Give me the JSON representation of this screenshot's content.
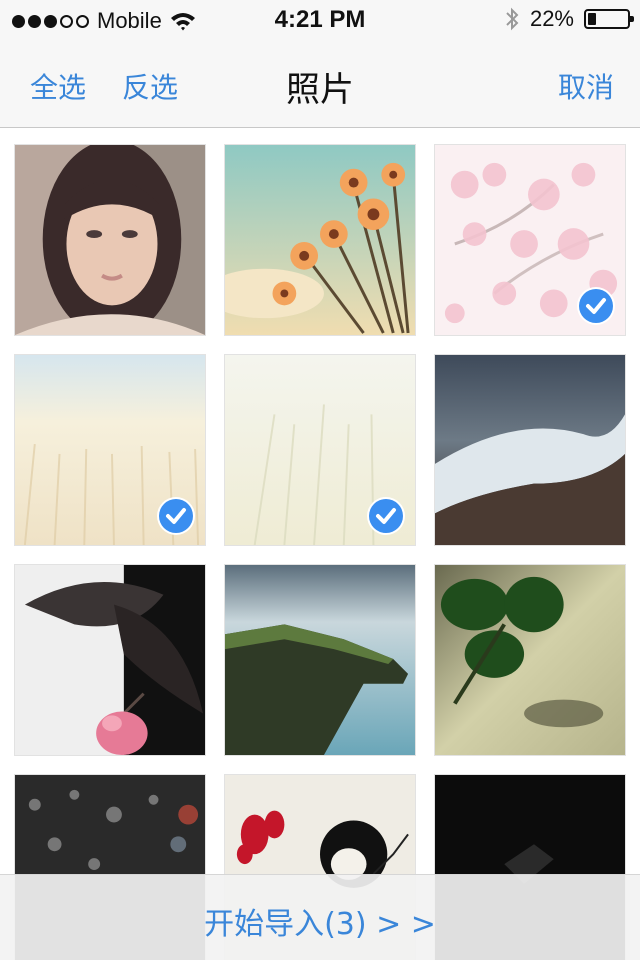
{
  "status_bar": {
    "carrier": "Mobile",
    "time": "4:21 PM",
    "battery_percent": "22%",
    "battery_level": 0.22,
    "signal_bars_filled": 3,
    "signal_bars_total": 5
  },
  "nav": {
    "select_all": "全选",
    "invert_selection": "反选",
    "title": "照片",
    "cancel": "取消"
  },
  "photos": [
    {
      "subject": "portrait of a woman with bangs",
      "selected": false
    },
    {
      "subject": "daisies against a sky",
      "selected": false
    },
    {
      "subject": "pink cherry blossoms",
      "selected": true
    },
    {
      "subject": "pale wheat field",
      "selected": true
    },
    {
      "subject": "faded grass field",
      "selected": true
    },
    {
      "subject": "ocean wave on beach",
      "selected": false
    },
    {
      "subject": "pink flower with dark leaves",
      "selected": false
    },
    {
      "subject": "sea cliffs",
      "selected": false
    },
    {
      "subject": "green clover leaf",
      "selected": false
    },
    {
      "subject": "rain drops on glass",
      "selected": false
    },
    {
      "subject": "illustration of a girl with red flower",
      "selected": false
    },
    {
      "subject": "dark object on black",
      "selected": false
    }
  ],
  "colors": {
    "accent": "#3a86d9",
    "check": "#3a8ef0",
    "bar_bg": "#f7f7f7"
  },
  "bottom": {
    "import_label": "开始导入(3) > >"
  }
}
